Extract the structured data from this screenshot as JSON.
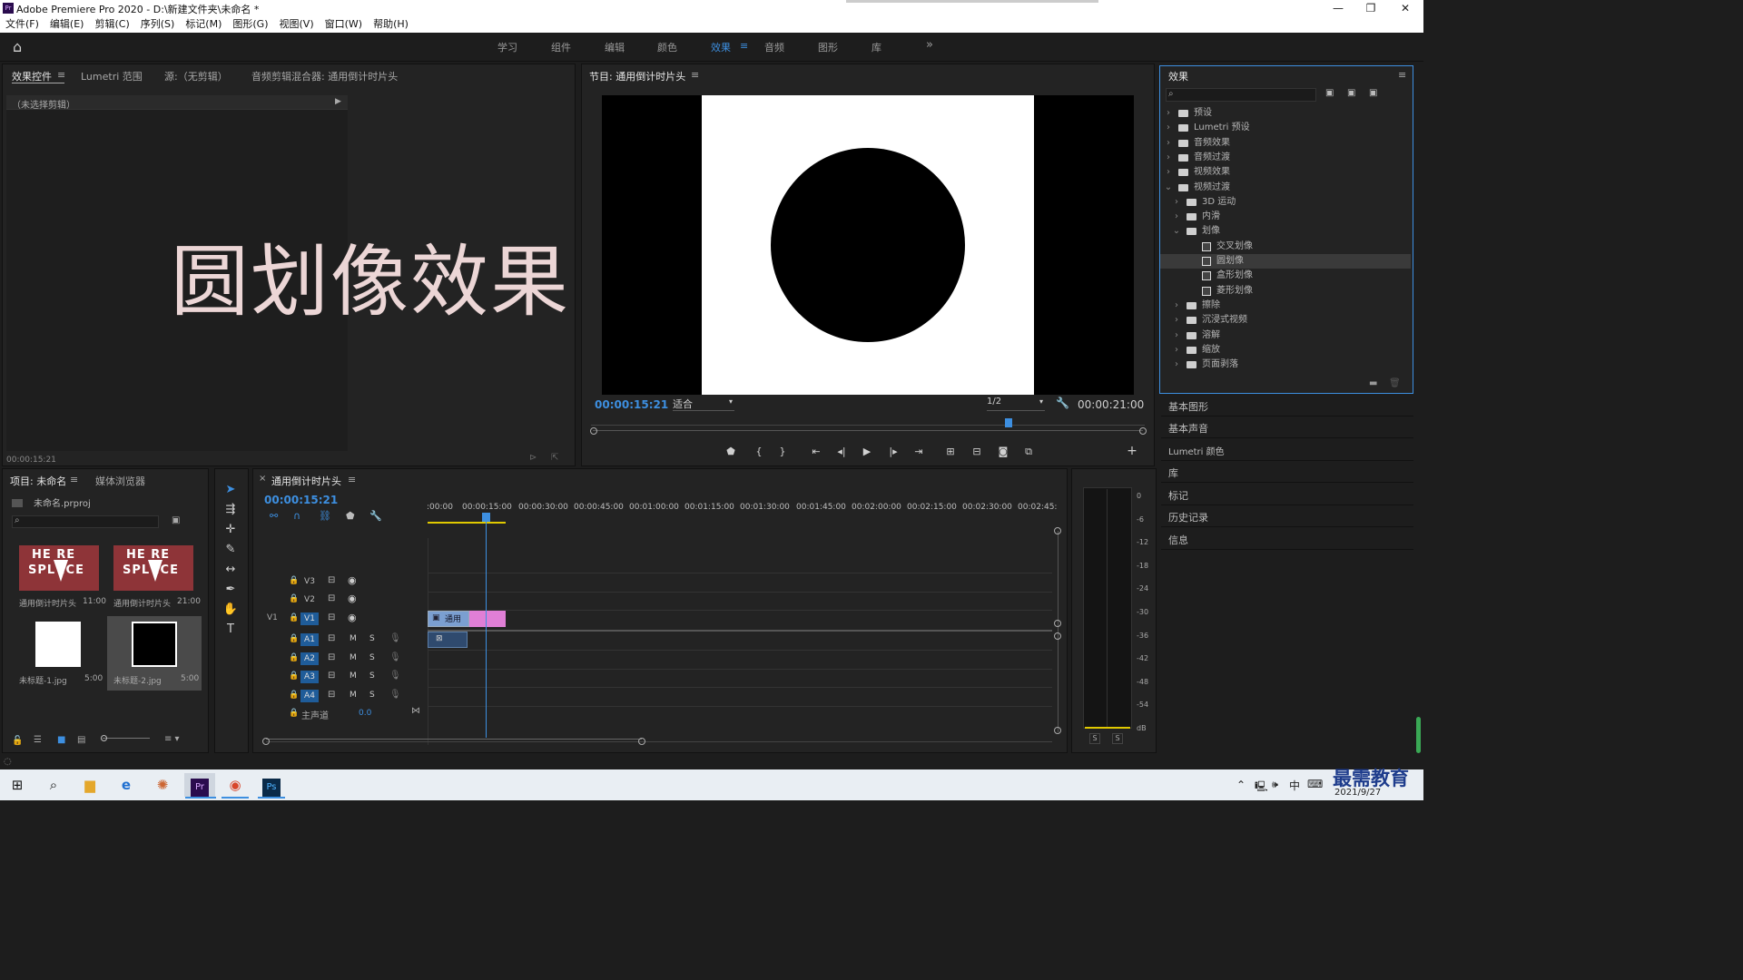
{
  "window": {
    "title": "Adobe Premiere Pro 2020 - D:\\新建文件夹\\未命名 *",
    "app_icon": "Pr"
  },
  "menu": [
    "文件(F)",
    "编辑(E)",
    "剪辑(C)",
    "序列(S)",
    "标记(M)",
    "图形(G)",
    "视图(V)",
    "窗口(W)",
    "帮助(H)"
  ],
  "workspaces": {
    "items": [
      "学习",
      "组件",
      "编辑",
      "颜色",
      "效果",
      "音频",
      "图形",
      "库"
    ],
    "active": "效果",
    "more": "»"
  },
  "effect_controls": {
    "tabs": [
      "效果控件",
      "Lumetri 范围",
      "源:（无剪辑）",
      "音频剪辑混合器: 通用倒计时片头"
    ],
    "no_clip": "（未选择剪辑）",
    "timecode": "00:00:15:21"
  },
  "overlay_text": "圆划像效果",
  "program": {
    "title": "节目: 通用倒计时片头",
    "timecode": "00:00:15:21",
    "fit": "适合",
    "resolution": "1/2",
    "duration": "00:00:21:00",
    "playhead_fraction": 0.754
  },
  "effects_panel": {
    "title": "效果",
    "search_placeholder": "",
    "tree": [
      {
        "label": "预设",
        "level": 0,
        "expanded": false,
        "type": "folder"
      },
      {
        "label": "Lumetri 预设",
        "level": 0,
        "expanded": false,
        "type": "folder"
      },
      {
        "label": "音频效果",
        "level": 0,
        "expanded": false,
        "type": "folder"
      },
      {
        "label": "音频过渡",
        "level": 0,
        "expanded": false,
        "type": "folder"
      },
      {
        "label": "视频效果",
        "level": 0,
        "expanded": false,
        "type": "folder"
      },
      {
        "label": "视频过渡",
        "level": 0,
        "expanded": true,
        "type": "folder"
      },
      {
        "label": "3D 运动",
        "level": 1,
        "expanded": false,
        "type": "folder"
      },
      {
        "label": "内滑",
        "level": 1,
        "expanded": false,
        "type": "folder"
      },
      {
        "label": "划像",
        "level": 1,
        "expanded": true,
        "type": "folder"
      },
      {
        "label": "交叉划像",
        "level": 2,
        "type": "effect"
      },
      {
        "label": "圆划像",
        "level": 2,
        "type": "effect",
        "selected": true
      },
      {
        "label": "盒形划像",
        "level": 2,
        "type": "effect"
      },
      {
        "label": "菱形划像",
        "level": 2,
        "type": "effect"
      },
      {
        "label": "擦除",
        "level": 1,
        "expanded": false,
        "type": "folder"
      },
      {
        "label": "沉浸式视频",
        "level": 1,
        "expanded": false,
        "type": "folder"
      },
      {
        "label": "溶解",
        "level": 1,
        "expanded": false,
        "type": "folder"
      },
      {
        "label": "缩放",
        "level": 1,
        "expanded": false,
        "type": "folder"
      },
      {
        "label": "页面剥落",
        "level": 1,
        "expanded": false,
        "type": "folder"
      }
    ]
  },
  "side_panels": [
    "基本图形",
    "基本声音",
    "Lumetri 颜色",
    "库",
    "标记",
    "历史记录",
    "信息"
  ],
  "project": {
    "tabs": [
      "项目: 未命名",
      "媒体浏览器"
    ],
    "file": "未命名.prproj",
    "items": [
      {
        "name": "通用倒计时片头",
        "duration": "11:00",
        "kind": "countdown"
      },
      {
        "name": "通用倒计时片头",
        "duration": "21:00",
        "kind": "countdown"
      },
      {
        "name": "未标题-1.jpg",
        "duration": "5:00",
        "kind": "white"
      },
      {
        "name": "未标题-2.jpg",
        "duration": "5:00",
        "kind": "black",
        "selected": true
      }
    ],
    "countdown_text_top": "HE RE",
    "countdown_text_bottom": "SPL ICE"
  },
  "timeline": {
    "title": "通用倒计时片头",
    "timecode": "00:00:15:21",
    "ruler": [
      ":00:00",
      "00:00:15:00",
      "00:00:30:00",
      "00:00:45:00",
      "00:01:00:00",
      "00:01:15:00",
      "00:01:30:00",
      "00:01:45:00",
      "00:02:00:00",
      "00:02:15:00",
      "00:02:30:00",
      "00:02:45:"
    ],
    "video_tracks": [
      "V3",
      "V2",
      "V1"
    ],
    "audio_tracks": [
      "A1",
      "A2",
      "A3",
      "A4"
    ],
    "source_v": "V1",
    "master": {
      "label": "主声道",
      "value": "0.0"
    },
    "clip_label": "通用",
    "track_buttons": {
      "mute": "M",
      "solo": "S"
    }
  },
  "meter": {
    "scale": [
      "0",
      "-6",
      "-12",
      "-18",
      "-24",
      "-30",
      "-36",
      "-42",
      "-48",
      "-54",
      "dB"
    ],
    "solo": [
      "S",
      "S"
    ]
  },
  "taskbar": {
    "ime": "中",
    "date": "2021/9/27",
    "watermark": "最需教育"
  },
  "colors": {
    "accent": "#3d8fe0",
    "clip_video": "#7b9fd1",
    "clip_pink": "#e07fd6",
    "overlay": "#ecd6d6"
  }
}
